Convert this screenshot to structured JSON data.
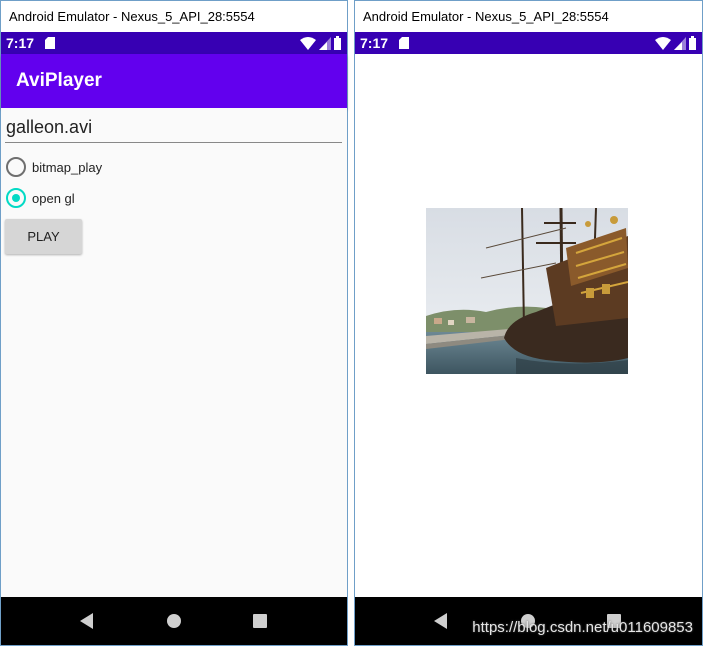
{
  "left_window": {
    "title": "Android Emulator - Nexus_5_API_28:5554",
    "status_time": "7:17",
    "app_title": "AviPlayer",
    "filename_input": "galleon.avi",
    "options": [
      {
        "label": "bitmap_play",
        "checked": false
      },
      {
        "label": "open gl",
        "checked": true
      }
    ],
    "play_label": "PLAY"
  },
  "right_window": {
    "title": "Android Emulator - Nexus_5_API_28:5554",
    "status_time": "7:17",
    "video_frame_icon": "galleon-ship-image"
  },
  "navigation": {
    "icons": [
      "back-icon",
      "home-icon",
      "recents-icon"
    ]
  },
  "colors": {
    "status_bar": "#3700b3",
    "app_bar": "#6200ee",
    "accent": "#03dac5"
  },
  "watermark": "https://blog.csdn.net/u011609853"
}
